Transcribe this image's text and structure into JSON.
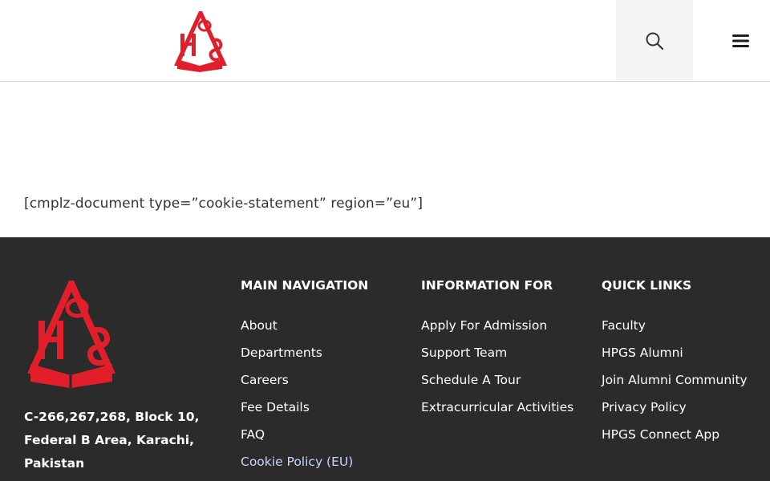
{
  "header": {
    "logo_icon": "hpgs-logo",
    "search_icon": "search-icon",
    "menu_icon": "hamburger-menu-icon"
  },
  "content": {
    "shortcode_text": "[cmplz-document type=”cookie-statement” region=”eu”]"
  },
  "footer": {
    "logo_icon": "hpgs-logo",
    "address": "C-266,267,268, Block 10, Federal B Area, Karachi, Pakistan",
    "columns": {
      "main_navigation": {
        "title": "MAIN NAVIGATION",
        "items": [
          "About",
          "Departments",
          "Careers",
          "Fee Details",
          "FAQ",
          "Cookie Policy (EU)"
        ]
      },
      "information_for": {
        "title": "INFORMATION FOR",
        "items": [
          "Apply For Admission",
          "Support Team",
          "Schedule A Tour",
          "Extracurricular Activities"
        ]
      },
      "quick_links": {
        "title": "QUICK LINKS",
        "items": [
          "Faculty",
          "HPGS Alumni",
          "Join Alumni Community",
          "Privacy Policy",
          "HPGS Connect App"
        ]
      }
    }
  },
  "colors": {
    "brand_red": "#e21e2a",
    "footer_bg": "#2b2b2b",
    "active_link": "#c9d4ff"
  }
}
